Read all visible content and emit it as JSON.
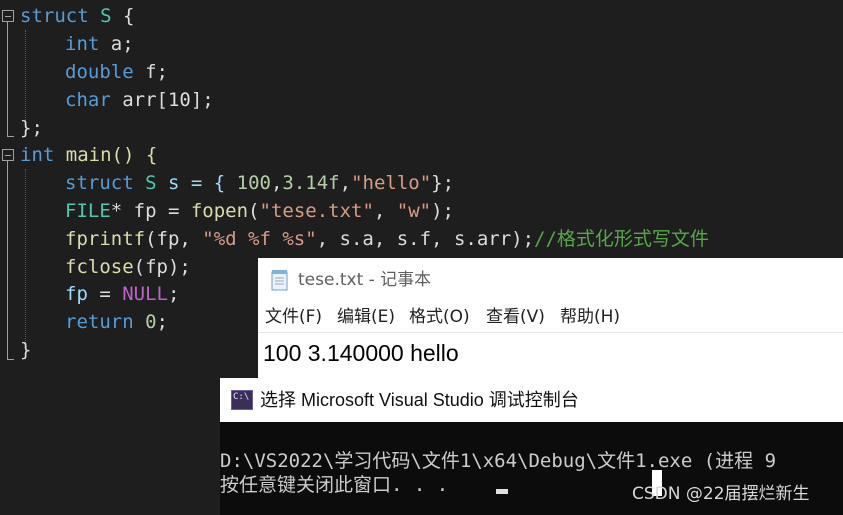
{
  "code": {
    "l1": {
      "kw": "struct",
      "name": "S",
      "brace": "{"
    },
    "l2": {
      "type": "int",
      "var": "a;"
    },
    "l3": {
      "type": "double",
      "var": "f;"
    },
    "l4": {
      "type": "char",
      "var": "arr[10];"
    },
    "l5": {
      "text": "};"
    },
    "l6": {
      "type": "int",
      "rest": "main() {"
    },
    "l7": {
      "kw": "struct",
      "name": "S",
      "rest1": "s = { ",
      "num1": "100",
      "c1": ",",
      "num2": "3.14f",
      "c2": ",",
      "str": "\"hello\"",
      "end": "};"
    },
    "l8": {
      "type": "FILE",
      "rest1": "* fp = ",
      "fn": "fopen",
      "p1": "(",
      "s1": "\"tese.txt\"",
      "c": ", ",
      "s2": "\"w\"",
      "end": ");"
    },
    "l9": {
      "fn": "fprintf",
      "p1": "(fp, ",
      "s1": "\"%d %f %s\"",
      "rest": ", s.a, s.f, s.arr);",
      "comment": "//格式化形式写文件"
    },
    "l10": {
      "fn": "fclose",
      "rest": "(fp);"
    },
    "l11": {
      "var": "fp",
      "eq": " = ",
      "mac": "NULL",
      "end": ";"
    },
    "l12": {
      "kw": "return",
      "num": "0",
      "end": ";"
    },
    "l13": {
      "text": "}"
    }
  },
  "notepad": {
    "title": "tese.txt - 记事本",
    "menu": [
      "文件(F)",
      "编辑(E)",
      "格式(O)",
      "查看(V)",
      "帮助(H)"
    ],
    "content": "100 3.140000 hello"
  },
  "console": {
    "title": "选择 Microsoft Visual Studio 调试控制台",
    "line1": "D:\\VS2022\\学习代码\\文件1\\x64\\Debug\\文件1.exe (进程 9",
    "line2": "按任意键关闭此窗口. . ."
  },
  "watermark": "CSDN @22届摆烂新生"
}
